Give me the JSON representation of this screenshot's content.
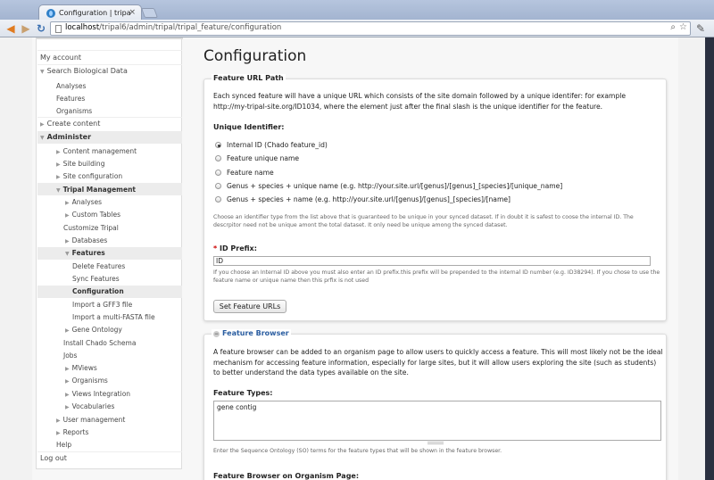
{
  "browser": {
    "tab_title": "Configuration | tripal v",
    "tab_close": "×",
    "url_host": "localhost",
    "url_path": "/tripal6/admin/tripal/tripal_feature/configuration"
  },
  "sidebar": {
    "items": [
      {
        "label": "My account"
      },
      {
        "label": "Search Biological Data"
      },
      {
        "label": "Analyses"
      },
      {
        "label": "Features"
      },
      {
        "label": "Organisms"
      },
      {
        "label": "Create content"
      },
      {
        "label": "Administer"
      },
      {
        "label": "Content management"
      },
      {
        "label": "Site building"
      },
      {
        "label": "Site configuration"
      },
      {
        "label": "Tripal Management"
      },
      {
        "label": "Analyses"
      },
      {
        "label": "Custom Tables"
      },
      {
        "label": "Customize Tripal"
      },
      {
        "label": "Databases"
      },
      {
        "label": "Features"
      },
      {
        "label": "Delete Features"
      },
      {
        "label": "Sync Features"
      },
      {
        "label": "Configuration"
      },
      {
        "label": "Import a GFF3 file"
      },
      {
        "label": "Import a multi-FASTA file"
      },
      {
        "label": "Gene Ontology"
      },
      {
        "label": "Install Chado Schema"
      },
      {
        "label": "Jobs"
      },
      {
        "label": "MViews"
      },
      {
        "label": "Organisms"
      },
      {
        "label": "Views Integration"
      },
      {
        "label": "Vocabularies"
      },
      {
        "label": "User management"
      },
      {
        "label": "Reports"
      },
      {
        "label": "Help"
      },
      {
        "label": "Log out"
      }
    ]
  },
  "main": {
    "title": "Configuration",
    "url_fieldset": {
      "legend": "Feature URL Path",
      "description": "Each synced feature will have a unique URL which consists of the site domain followed by a unique identifer: for example http://my-tripal-site.org/ID1034, where the element just after the final slash is the unique identifier for the feature.",
      "unique_identifier_label": "Unique Identifier:",
      "options": [
        {
          "label": "Internal ID (Chado feature_id)",
          "checked": true
        },
        {
          "label": "Feature unique name",
          "checked": false
        },
        {
          "label": "Feature name",
          "checked": false
        },
        {
          "label": "Genus + species + unique name (e.g. http://your.site.url/[genus]/[genus]_[species]/[unique_name]",
          "checked": false
        },
        {
          "label": "Genus + species + name (e.g. http://your.site.url/[genus]/[genus]_[species]/[name]",
          "checked": false
        }
      ],
      "options_help": "Choose an identifier type from the list above that is guaranteed to be unique in your synced dataset. If in doubt it is safest to coose the internal ID. The descrpitor need not be unique amont the total dataset. It only need be unique among the synced dataset.",
      "id_prefix_required": "*",
      "id_prefix_label": "ID Prefix:",
      "id_prefix_value": "ID",
      "id_prefix_help": "If you choose an Internal ID above you must also enter an ID prefix.this prefix will be prepended to the internal ID number (e.g. ID38294). If you chose to use the feature name or unique name then this prfix is not used",
      "submit_label": "Set Feature URLs"
    },
    "browser_fieldset": {
      "collapse_icon": "−",
      "legend": "Feature Browser",
      "description": "A feature browser can be added to an organism page to allow users to quickly access a feature. This will most likely not be the ideal mechanism for accessing feature information, especially for large sites, but it will allow users exploring the site (such as students) to better understand the data types available on the site.",
      "feature_types_label": "Feature Types:",
      "feature_types_value": "gene contig",
      "feature_types_help": "Enter the Sequence Ontology (SO) terms for the feature types that will be shown in the feature browser.",
      "next_label": "Feature Browser on Organism Page:"
    }
  }
}
